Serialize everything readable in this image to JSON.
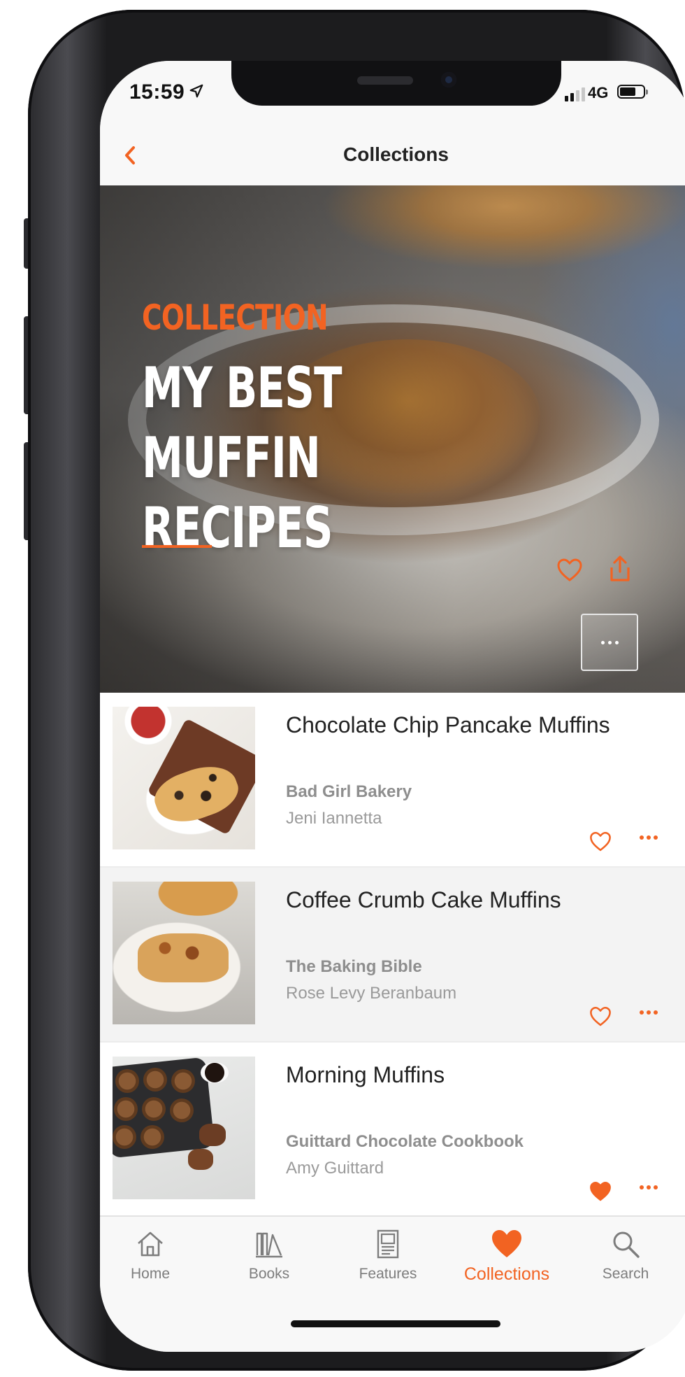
{
  "status_bar": {
    "time": "15:59",
    "network": "4G"
  },
  "nav": {
    "title": "Collections"
  },
  "hero": {
    "kicker": "COLLECTION",
    "title": "MY BEST MUFFIN RECIPES"
  },
  "recipes": [
    {
      "title": "Chocolate Chip Pancake Muffins",
      "book": "Bad Girl Bakery",
      "author": "Jeni Iannetta",
      "favorited": false
    },
    {
      "title": "Coffee Crumb Cake Muffins",
      "book": "The Baking Bible",
      "author": "Rose Levy Beranbaum",
      "favorited": false
    },
    {
      "title": "Morning Muffins",
      "book": "Guittard Chocolate Cookbook",
      "author": "Amy Guittard",
      "favorited": true
    }
  ],
  "tabs": [
    {
      "label": "Home",
      "icon": "home-icon"
    },
    {
      "label": "Books",
      "icon": "books-icon"
    },
    {
      "label": "Features",
      "icon": "features-icon"
    },
    {
      "label": "Collections",
      "icon": "heart-icon",
      "active": true
    },
    {
      "label": "Search",
      "icon": "search-icon"
    }
  ],
  "colors": {
    "accent": "#f26322",
    "text": "#222222",
    "muted": "#8e8e8e"
  }
}
